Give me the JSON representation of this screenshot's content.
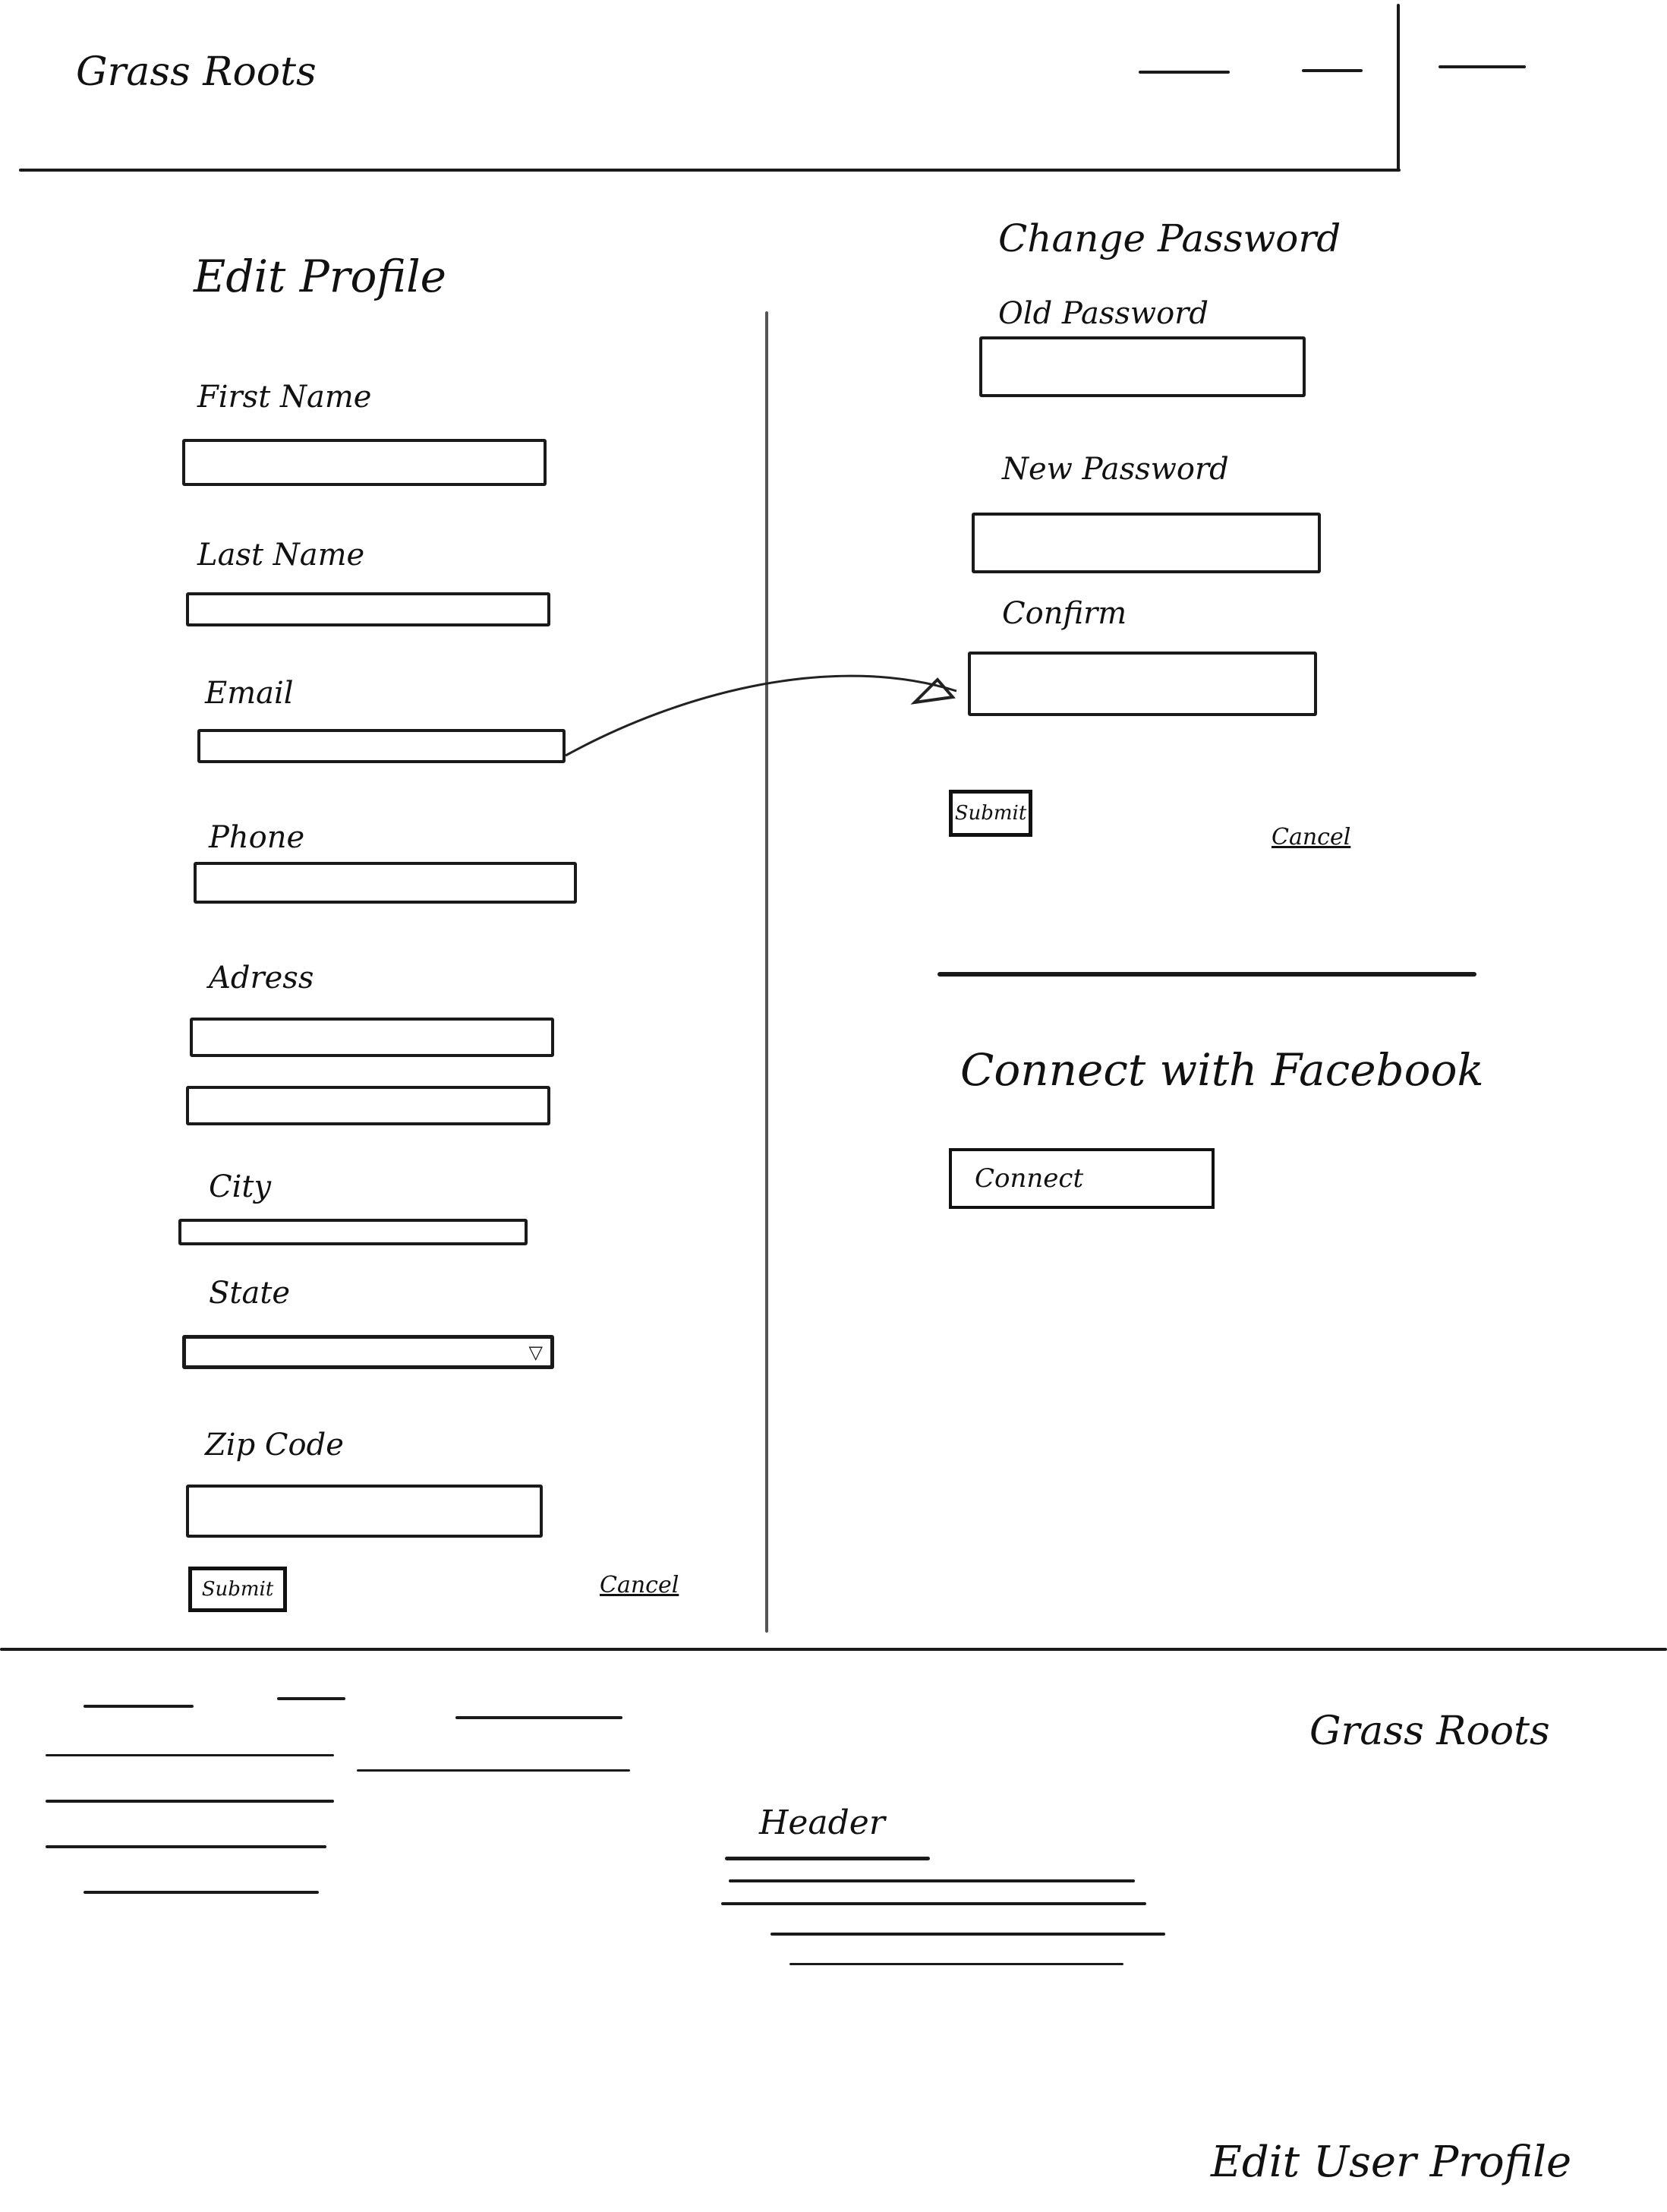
{
  "header": {
    "brand": "Grass Roots"
  },
  "edit_profile": {
    "title": "Edit Profile",
    "fields": {
      "first_name": "First Name",
      "last_name": "Last Name",
      "email": "Email",
      "phone": "Phone",
      "address": "Adress",
      "city": "City",
      "state": "State",
      "zip": "Zip Code"
    },
    "submit": "Submit",
    "cancel": "Cancel"
  },
  "change_password": {
    "title": "Change Password",
    "fields": {
      "old": "Old Password",
      "new": "New Password",
      "confirm": "Confirm"
    },
    "submit": "Submit",
    "cancel": "Cancel"
  },
  "facebook": {
    "title": "Connect with Facebook",
    "button": "Connect"
  },
  "footer": {
    "brand": "Grass Roots",
    "heading": "Header"
  },
  "page_caption": "Edit User Profile"
}
